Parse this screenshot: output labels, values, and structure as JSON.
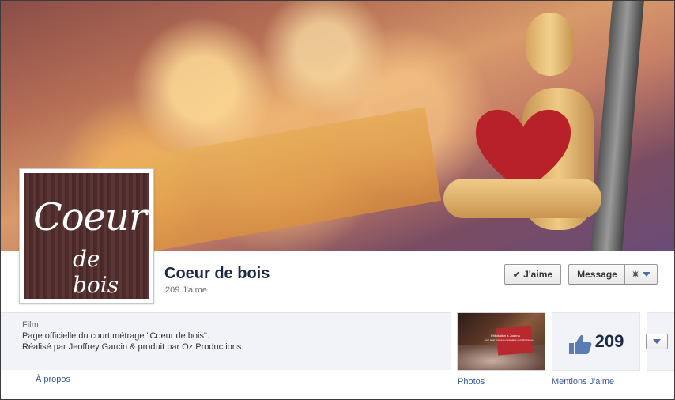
{
  "page": {
    "name": "Coeur de bois",
    "likes_text": "209 J'aime"
  },
  "profile_logo": {
    "line1": "Coeur",
    "line2": "de bois"
  },
  "actions": {
    "like_label": "J'aime",
    "message_label": "Message"
  },
  "about": {
    "category": "Film",
    "line1": "Page officielle du court métrage \"Coeur de bois\".",
    "line2": "Réalisé par Jeoffrey Garcin & produit par Oz Productions.",
    "link": "À propos"
  },
  "apps": {
    "photos": {
      "label": "Photos",
      "caption1": "Félicitation à Joanna",
      "caption2": "pour avoir trouvé la carte dans sa bibliothèque"
    },
    "likes": {
      "count": "209",
      "label": "Mentions J'aime"
    }
  },
  "colors": {
    "link": "#3b5998",
    "name": "#1c2a47",
    "tile_bg": "#f1f3f8",
    "heart": "#b8202a"
  },
  "icons": [
    "check-icon",
    "gear-icon",
    "dropdown-arrow-icon",
    "thumbs-up-icon"
  ]
}
